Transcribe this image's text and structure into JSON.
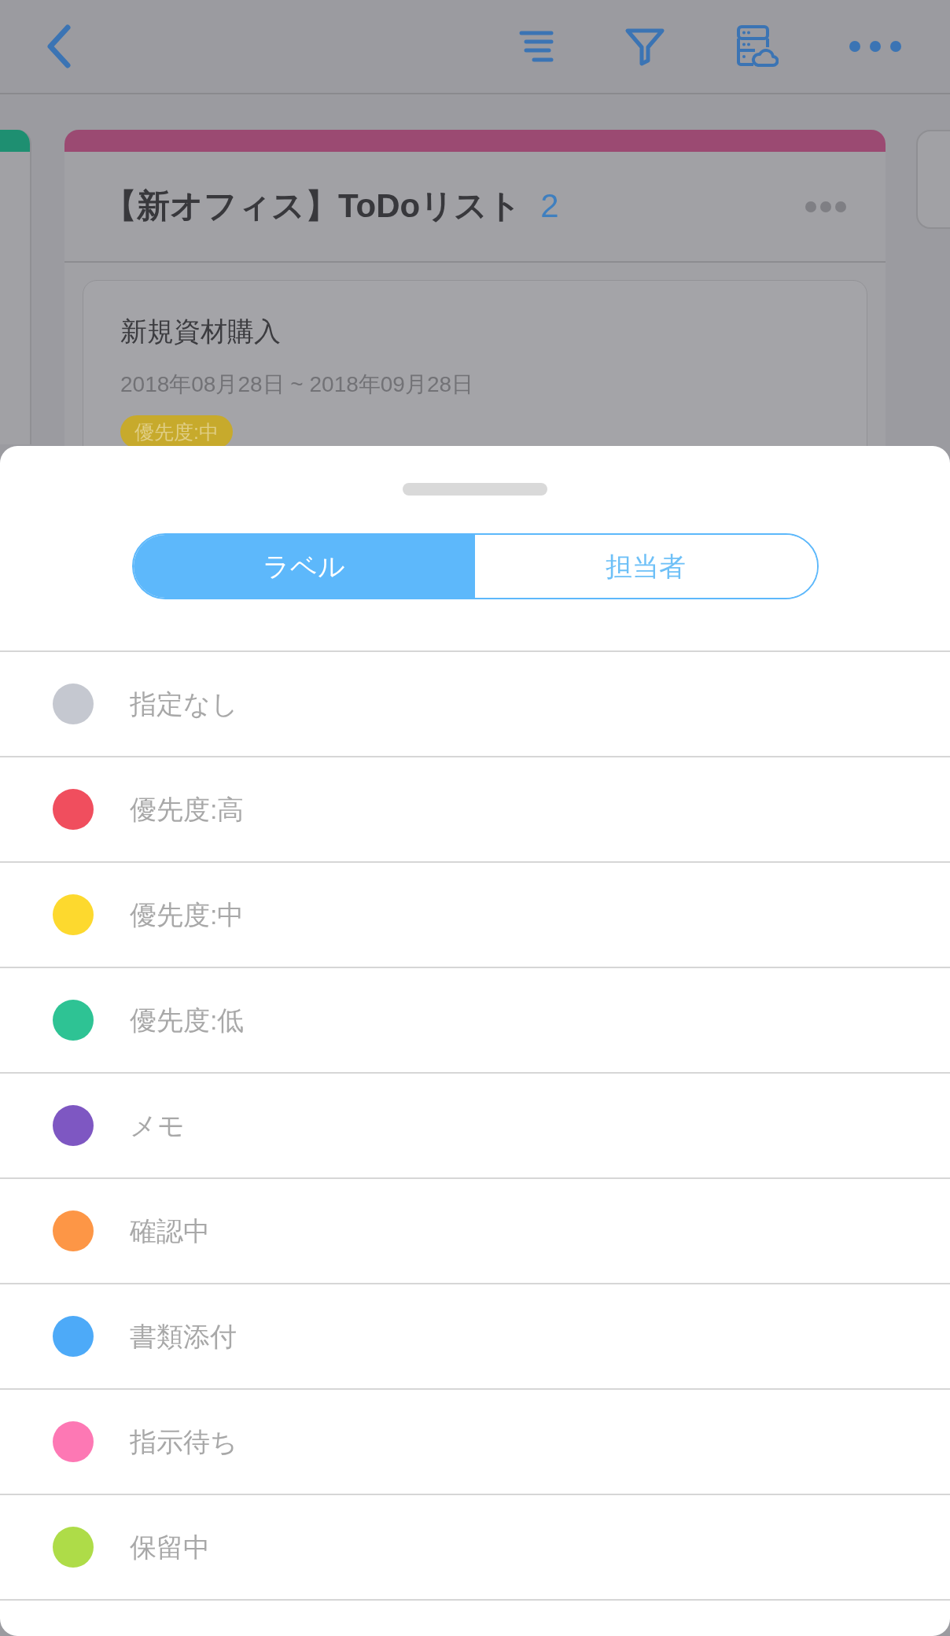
{
  "board": {
    "columns": [
      {
        "kind": "edge",
        "color": "#1e8f71"
      },
      {
        "kind": "list",
        "color": "#9b4a72",
        "title": "【新オフィス】ToDoリスト",
        "count": "2",
        "cards": [
          {
            "title": "新規資材購入",
            "period": "2018年08月28日 ~ 2018年09月28日",
            "labels": [
              {
                "text": "優先度:中",
                "color": "#c7aa2c"
              }
            ]
          }
        ]
      },
      {
        "kind": "edge"
      }
    ]
  },
  "sheet": {
    "tabs": [
      {
        "label": "ラベル",
        "selected": true
      },
      {
        "label": "担当者",
        "selected": false
      }
    ],
    "labels": [
      {
        "text": "指定なし",
        "color": "#c5c8d0"
      },
      {
        "text": "優先度:高",
        "color": "#f04e5e"
      },
      {
        "text": "優先度:中",
        "color": "#fdd92e"
      },
      {
        "text": "優先度:低",
        "color": "#2ec394"
      },
      {
        "text": "メモ",
        "color": "#7e57c2"
      },
      {
        "text": "確認中",
        "color": "#fd9646"
      },
      {
        "text": "書類添付",
        "color": "#4daaf8"
      },
      {
        "text": "指示待ち",
        "color": "#fd78b4"
      },
      {
        "text": "保留中",
        "color": "#aedc48"
      }
    ]
  }
}
